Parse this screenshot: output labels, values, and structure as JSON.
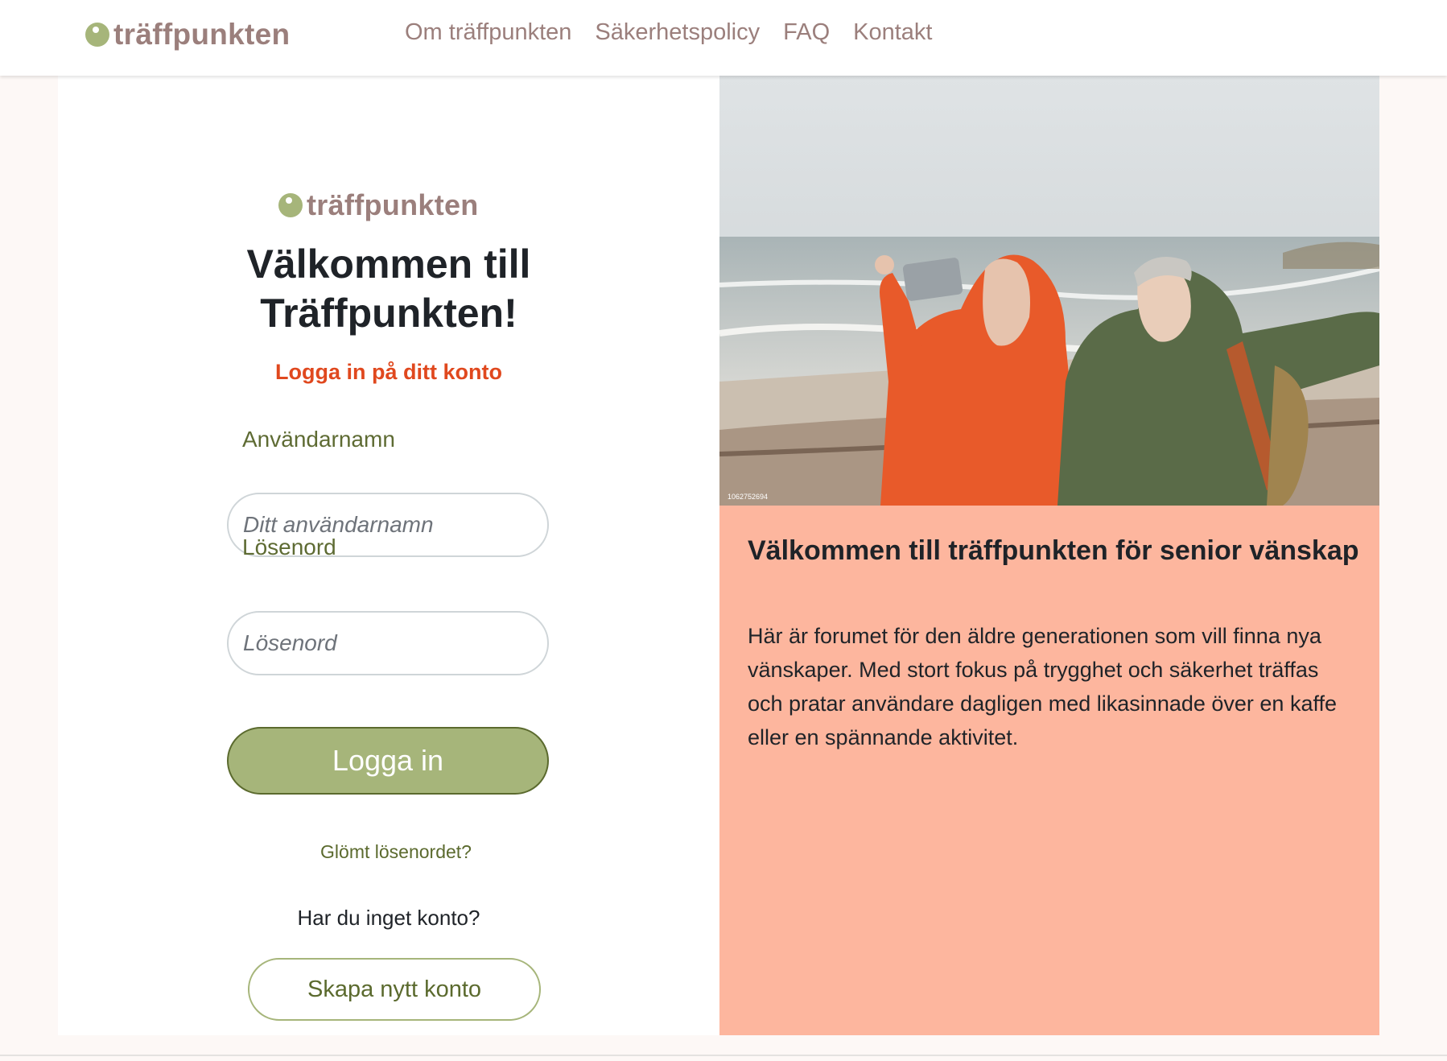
{
  "header": {
    "logo_text": "träffpunkten",
    "nav": [
      "Om träffpunkten",
      "Säkerhetspolicy",
      "FAQ",
      "Kontakt"
    ]
  },
  "login": {
    "logo_text": "träffpunkten",
    "welcome_line1": "Välkommen till",
    "welcome_line2": "Träffpunkten!",
    "subtitle": "Logga in på ditt konto",
    "username_label": "Användarnamn",
    "username_placeholder": "Ditt användarnamn",
    "password_label": "Lösenord",
    "password_placeholder": "Lösenord",
    "login_button": "Logga in",
    "forgot_link": "Glömt lösenordet?",
    "no_account_text": "Har du inget konto?",
    "create_button": "Skapa nytt konto"
  },
  "info": {
    "photo_id": "1062752694",
    "title": "Välkommen till träffpunkten för senior vänskap",
    "body": "Här är forumet för den äldre generationen som vill finna nya vänskaper. Med stort fokus på trygghet och säkerhet träffas och pratar användare dagligen med likasinnade över en kaffe eller en spännande aktivitet."
  },
  "colors": {
    "brand_green": "#a6b57a",
    "brand_mauve": "#9b7f7c",
    "accent_orange": "#e0481e",
    "info_background": "#fdb69e"
  },
  "icons": {
    "logo_mark": "green-dot-icon"
  }
}
